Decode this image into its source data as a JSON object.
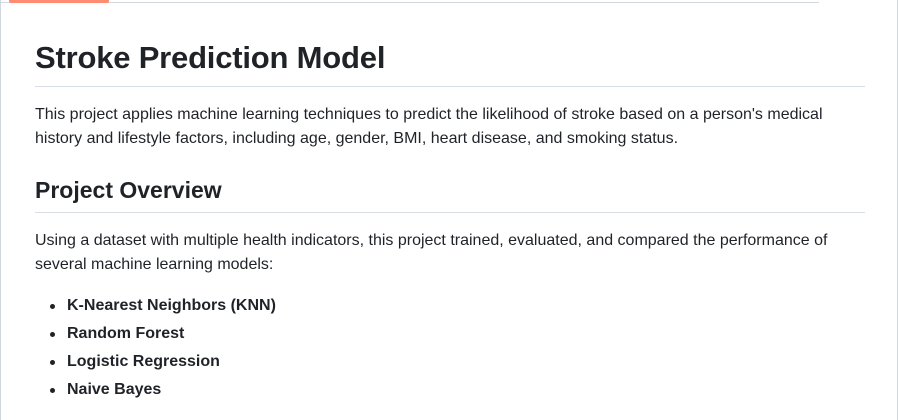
{
  "readme": {
    "title": "Stroke Prediction Model",
    "intro": "This project applies machine learning techniques to predict the likelihood of stroke based on a person's medical history and lifestyle factors, including age, gender, BMI, heart disease, and smoking status.",
    "section_heading": "Project Overview",
    "overview_text": "Using a dataset with multiple health indicators, this project trained, evaluated, and compared the performance of several machine learning models:",
    "models": [
      "K-Nearest Neighbors (KNN)",
      "Random Forest",
      "Logistic Regression",
      "Naive Bayes"
    ]
  },
  "colors": {
    "text": "#1f2328",
    "rule": "#d8dee4",
    "active_tab_indicator": "#fd8c73"
  }
}
